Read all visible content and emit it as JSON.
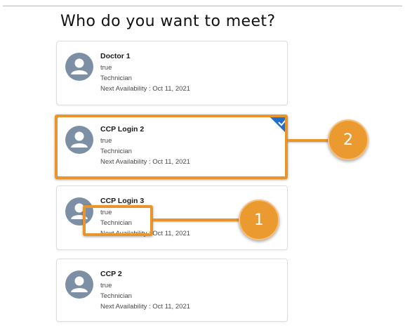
{
  "page_title": "Who do you want to meet?",
  "cards": [
    {
      "name": "Doctor 1",
      "status": "true",
      "role": "Technician",
      "availability": "Next Availability : Oct 11, 2021",
      "selected": false
    },
    {
      "name": "CCP Login 2",
      "status": "true",
      "role": "Technician",
      "availability": "Next Availability : Oct 11, 2021",
      "selected": true
    },
    {
      "name": "CCP Login 3",
      "status": "true",
      "role": "Technician",
      "availability": "Next Availability : Oct 11, 2021",
      "selected": false
    },
    {
      "name": "CCP 2",
      "status": "true",
      "role": "Technician",
      "availability": "Next Availability : Oct 11, 2021",
      "selected": false
    }
  ],
  "callouts": [
    {
      "number": "2"
    },
    {
      "number": "1"
    }
  ],
  "colors": {
    "accent": "#1d6fd6",
    "annotation": "#e8962c",
    "avatar": "#7d8fa4"
  },
  "icons": {
    "avatar": "user-icon",
    "selected_marker": "checkmark-icon"
  }
}
